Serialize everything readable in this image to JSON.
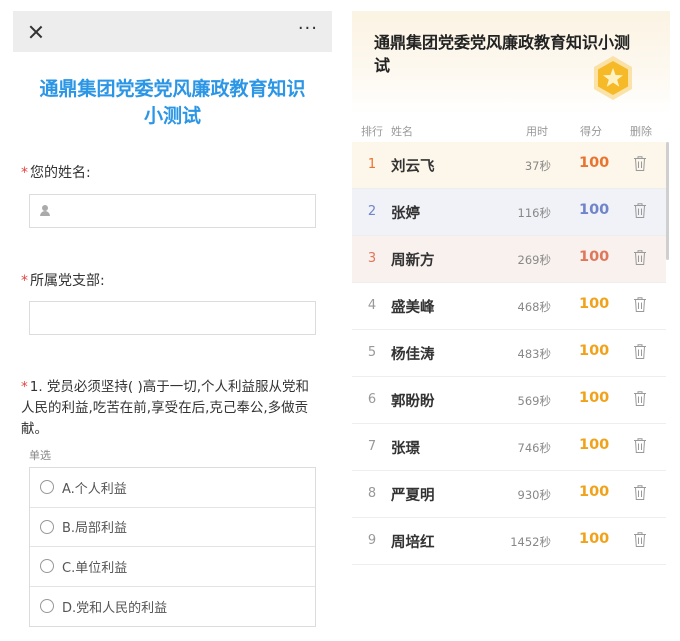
{
  "form": {
    "title": "通鼎集团党委党风廉政教育知识小测试",
    "more_label": "···",
    "required_mark": "*",
    "fields": [
      {
        "label": "您的姓名:",
        "value": ""
      },
      {
        "label": "所属党支部:",
        "value": ""
      }
    ],
    "question": {
      "text": "1. 党员必须坚持( )高于一切,个人利益服从党和人民的利益,吃苦在前,享受在后,克己奉公,多做贡献。",
      "type": "单选",
      "options": [
        "A.个人利益",
        "B.局部利益",
        "C.单位利益",
        "D.党和人民的利益"
      ]
    }
  },
  "leaderboard": {
    "title": "通鼎集团党委党风廉政教育知识小测试",
    "columns": {
      "rank": "排行",
      "name": "姓名",
      "time": "用时",
      "score": "得分",
      "delete": "删除"
    },
    "rows": [
      {
        "rank": "1",
        "name": "刘云飞",
        "time": "37秒",
        "score": "100"
      },
      {
        "rank": "2",
        "name": "张婷",
        "time": "116秒",
        "score": "100"
      },
      {
        "rank": "3",
        "name": "周新方",
        "time": "269秒",
        "score": "100"
      },
      {
        "rank": "4",
        "name": "盛美峰",
        "time": "468秒",
        "score": "100"
      },
      {
        "rank": "5",
        "name": "杨佳涛",
        "time": "483秒",
        "score": "100"
      },
      {
        "rank": "6",
        "name": "郭盼盼",
        "time": "569秒",
        "score": "100"
      },
      {
        "rank": "7",
        "name": "张璟",
        "time": "746秒",
        "score": "100"
      },
      {
        "rank": "8",
        "name": "严夏明",
        "time": "930秒",
        "score": "100"
      },
      {
        "rank": "9",
        "name": "周培红",
        "time": "1452秒",
        "score": "100"
      }
    ]
  },
  "colors": {
    "form_title": "#2b95e6",
    "required": "#e64340",
    "gold": "#f1a21b",
    "rank1": "#e8742f",
    "rank2": "#6f84c9",
    "rank3": "#e0765a"
  }
}
